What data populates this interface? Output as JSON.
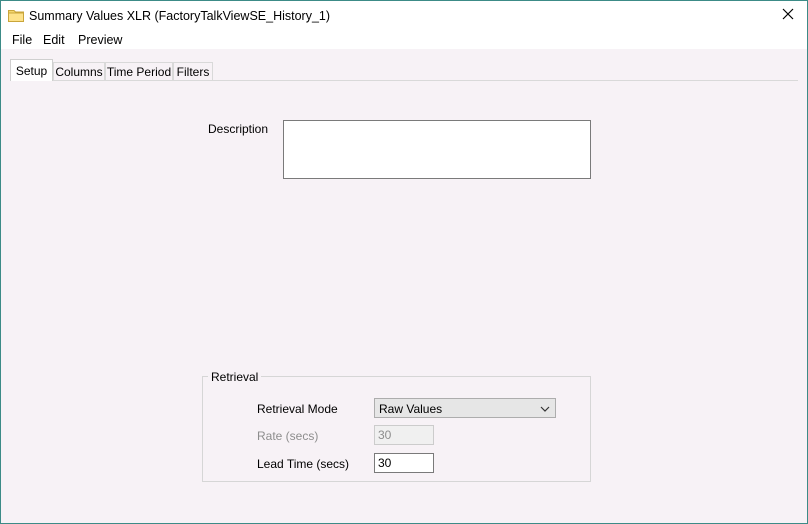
{
  "window": {
    "title": "Summary Values XLR (FactoryTalkViewSE_History_1)",
    "title_icon": "folder-icon",
    "close_icon": "close-icon"
  },
  "menu": {
    "items": [
      "File",
      "Edit",
      "Preview"
    ]
  },
  "tabs": {
    "items": [
      "Setup",
      "Columns",
      "Time Period",
      "Filters"
    ],
    "active": "Setup"
  },
  "setup": {
    "description_label": "Description",
    "description_value": "",
    "retrieval": {
      "group_title": "Retrieval",
      "mode_label": "Retrieval Mode",
      "mode_value": "Raw Values",
      "rate_label": "Rate (secs)",
      "rate_value": "30",
      "lead_time_label": "Lead Time (secs)",
      "lead_time_value": "30"
    }
  },
  "colors": {
    "border": "#3c8b87",
    "panel_background": "#f7f2f6"
  }
}
